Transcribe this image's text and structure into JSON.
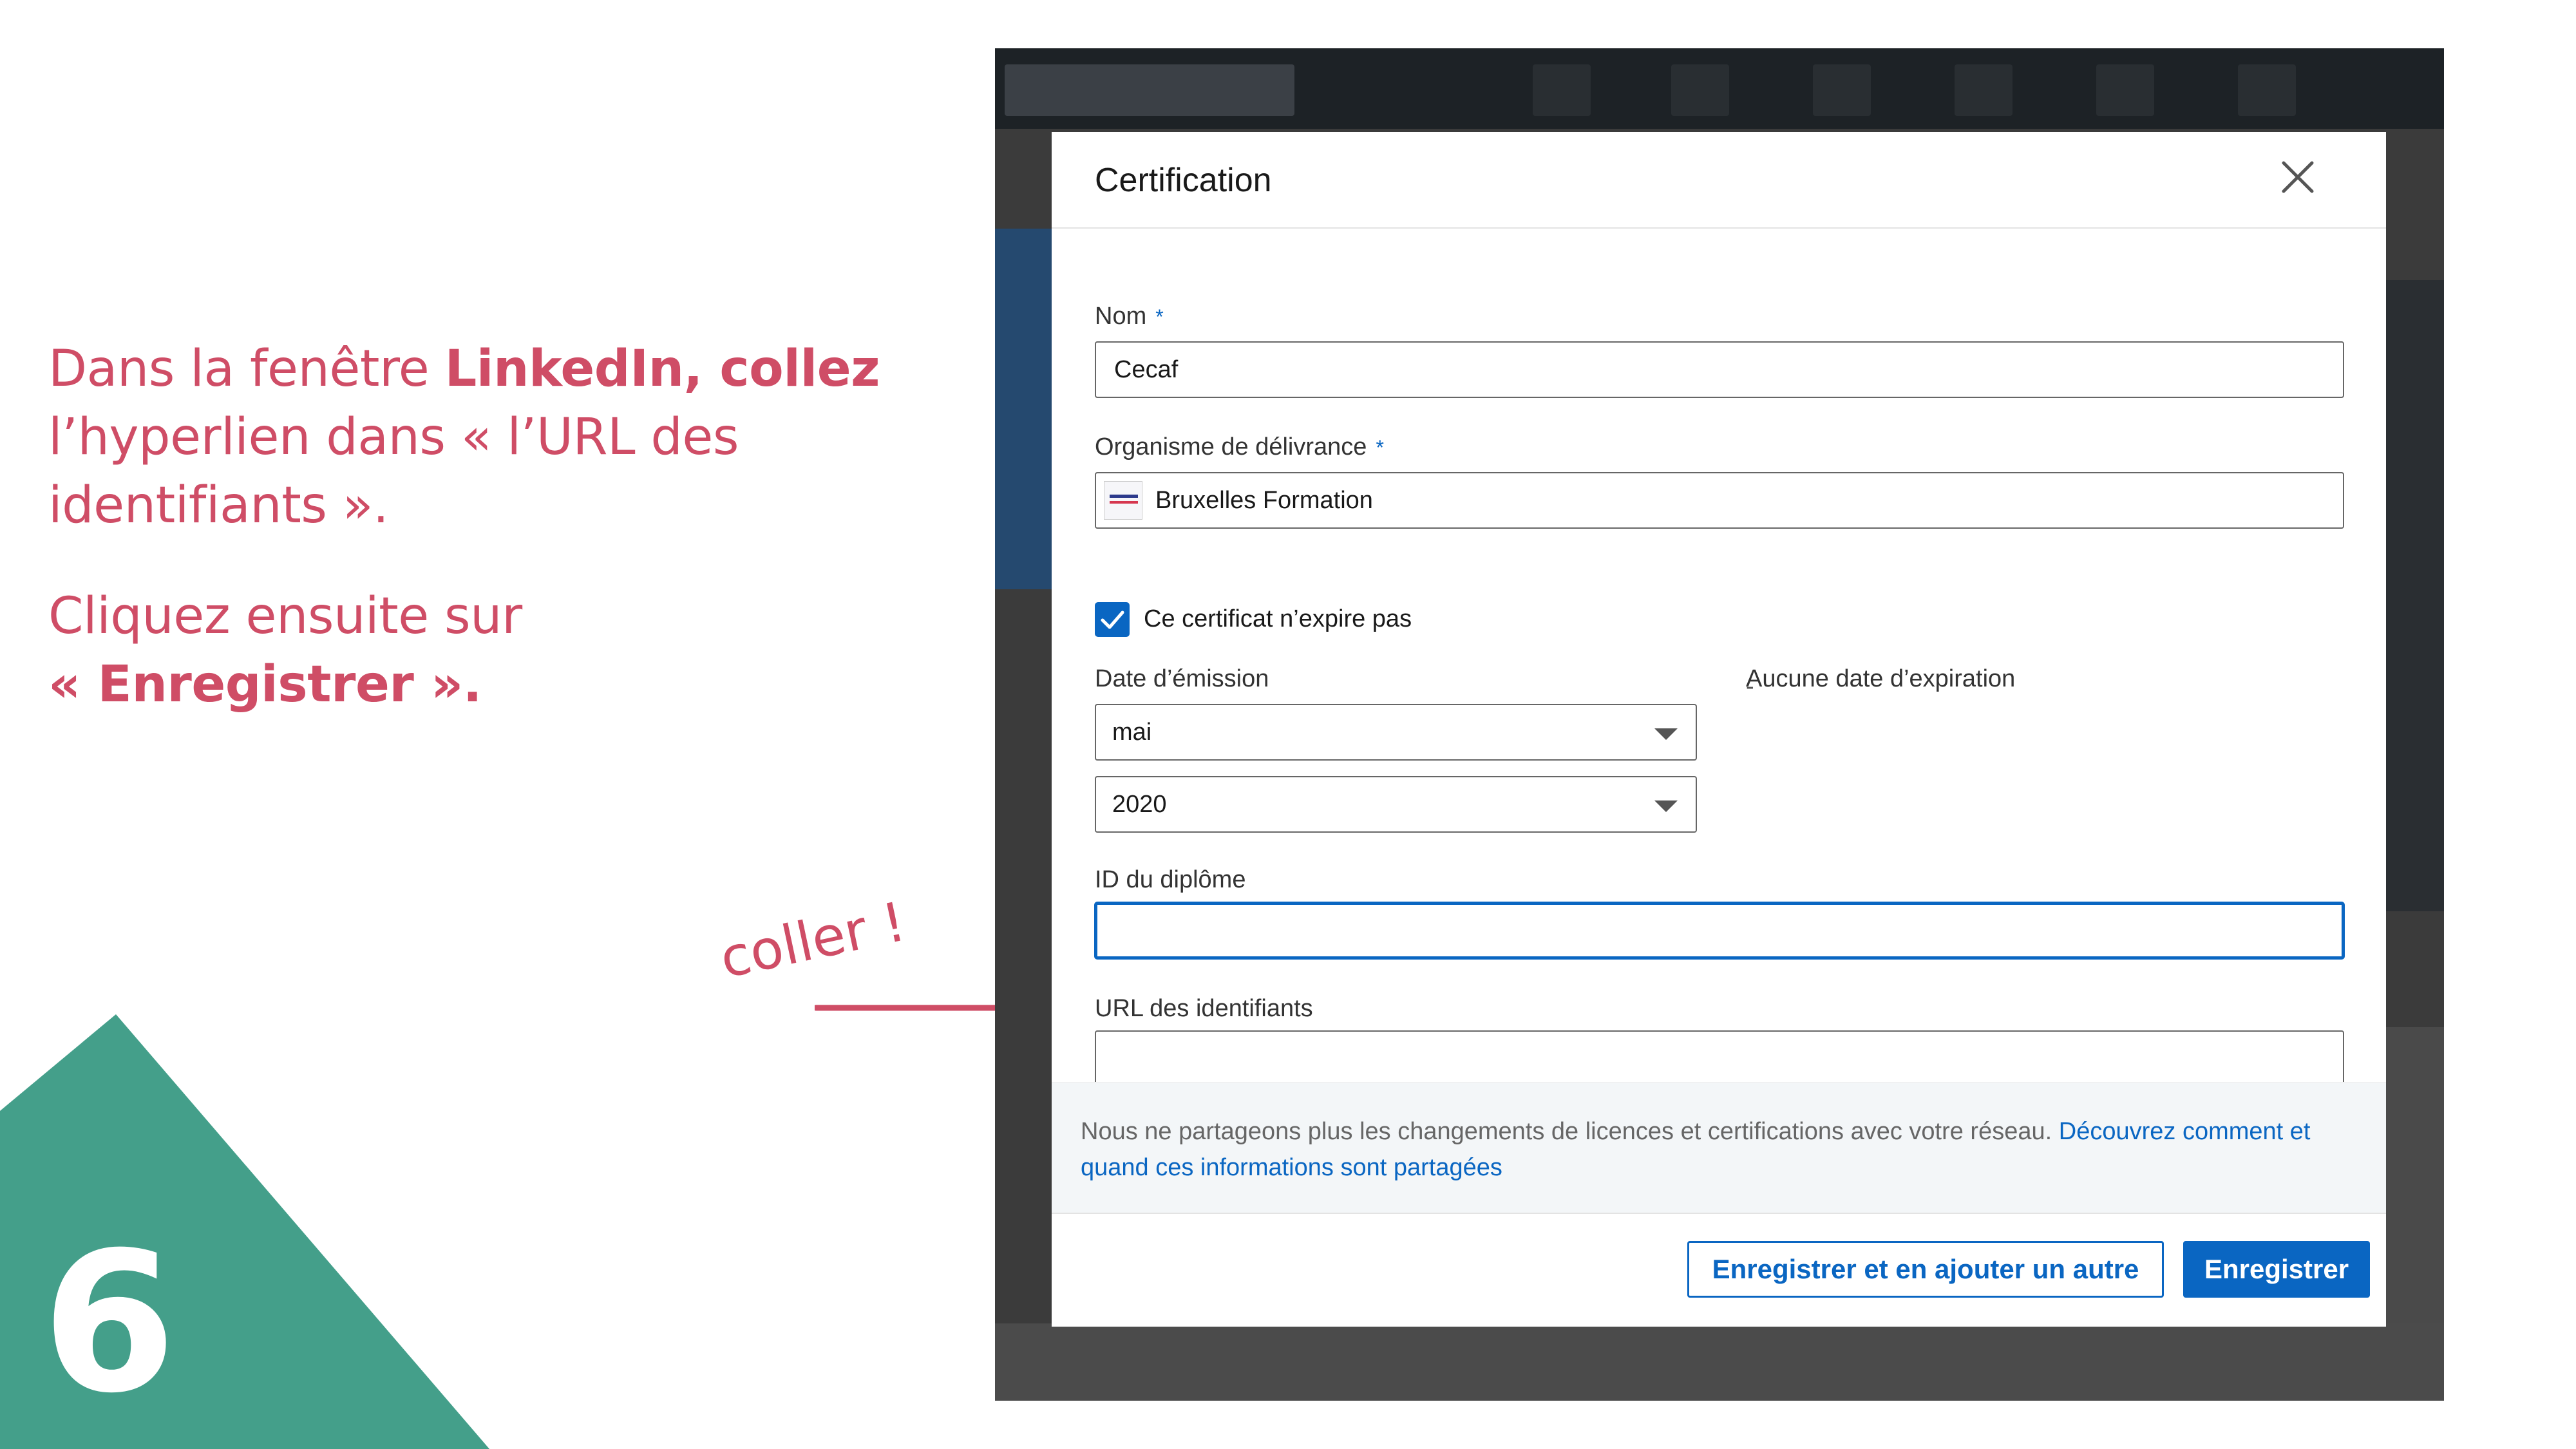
{
  "instructions": {
    "line1_a": "Dans la fenêtre ",
    "line1_b": "LinkedIn, collez",
    "line2": "l’hyperlien dans « l’URL des",
    "line3": "identifiants ».",
    "line4": "Cliquez ensuite sur",
    "line5": "« Enregistrer »."
  },
  "annotation": {
    "note": "coller !"
  },
  "step": {
    "number": "6"
  },
  "colors": {
    "accent": "#cf4d66",
    "teal": "#449f8a",
    "linkedin_blue": "#0a66c2"
  },
  "modal": {
    "title": "Certification",
    "name_label": "Nom",
    "name_required": "*",
    "name_value": "Cecaf",
    "org_label": "Organisme de délivrance",
    "org_required": "*",
    "org_value": "Bruxelles Formation",
    "no_expiry_label": "Ce certificat n’expire pas",
    "no_expiry_checked": true,
    "issue_date_label": "Date d’émission",
    "issue_month": "mai",
    "issue_year": "2020",
    "expiry_label": "Aucune date d’expiration",
    "expiry_value": "-",
    "credential_id_label": "ID du diplôme",
    "credential_id_value": "",
    "credential_url_label": "URL des identifiants",
    "credential_url_value": "",
    "notice_text": "Nous ne partageons plus les changements de licences et certifications avec votre réseau. ",
    "notice_link": "Découvrez comment et quand ces informations sont partagées",
    "save_and_add_label": "Enregistrer et en ajouter un autre",
    "save_label": "Enregistrer"
  }
}
